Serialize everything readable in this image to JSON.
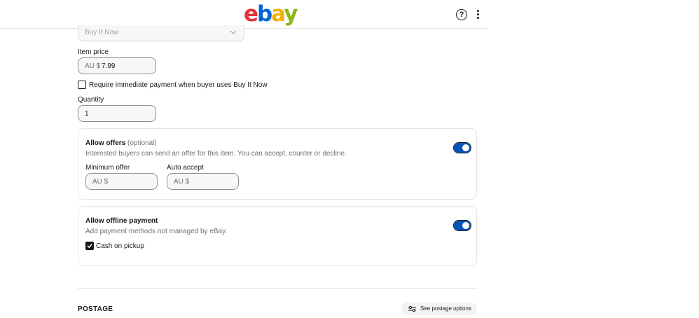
{
  "header": {
    "logo_letters": [
      "e",
      "b",
      "a",
      "y"
    ],
    "help_symbol": "?"
  },
  "format_select": {
    "value": "Buy It Now"
  },
  "item_price": {
    "label": "Item price",
    "currency": "AU $",
    "value": "7.99"
  },
  "immediate_payment": {
    "label": "Require immediate payment when buyer uses Buy It Now",
    "checked": false
  },
  "quantity": {
    "label": "Quantity",
    "value": "1"
  },
  "allow_offers": {
    "title": "Allow offers",
    "optional": "(optional)",
    "description": "Interested buyers can send an offer for this item. You can accept, counter or decline.",
    "enabled": true,
    "minimum_offer": {
      "label": "Minimum offer",
      "currency": "AU $"
    },
    "auto_accept": {
      "label": "Auto accept",
      "currency": "AU $"
    }
  },
  "offline_payment": {
    "title": "Allow offline payment",
    "description": "Add payment methods not managed by eBay.",
    "enabled": true,
    "cash_on_pickup": {
      "label": "Cash on pickup",
      "checked": true
    }
  },
  "postage": {
    "heading": "POSTAGE",
    "options_button": "See postage options"
  },
  "colors": {
    "accent": "#0654ba",
    "toggle_on": "#0654ba"
  },
  "icons": [
    "help-icon",
    "more-vertical-icon",
    "chevron-down-icon",
    "checkmark-icon",
    "sliders-icon"
  ]
}
